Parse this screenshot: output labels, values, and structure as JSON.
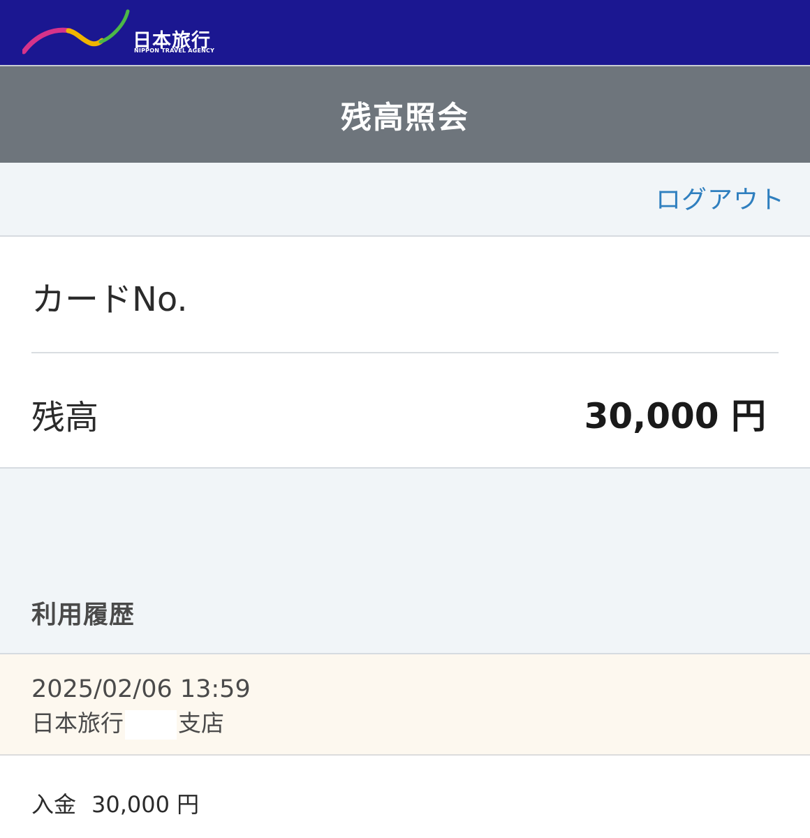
{
  "brand": {
    "name_jp": "日本旅行",
    "name_en": "NIPPON TRAVEL AGENCY",
    "colors": {
      "header_bg": "#1b1791",
      "title_bar_bg": "#6e757c",
      "link": "#2f7fbf",
      "history_item_bg": "#fdf8ef"
    }
  },
  "header": {
    "title": "残高照会",
    "logout_label": "ログアウト"
  },
  "card": {
    "card_no_label": "カードNo.",
    "card_no_value": "",
    "balance_label": "残高",
    "balance_value": "30,000 円"
  },
  "history": {
    "title": "利用履歴",
    "items": [
      {
        "datetime": "2025/02/06 13:59",
        "store_prefix": "日本旅行",
        "store_suffix": "支店",
        "type": "入金",
        "amount": "30,000 円"
      }
    ]
  }
}
